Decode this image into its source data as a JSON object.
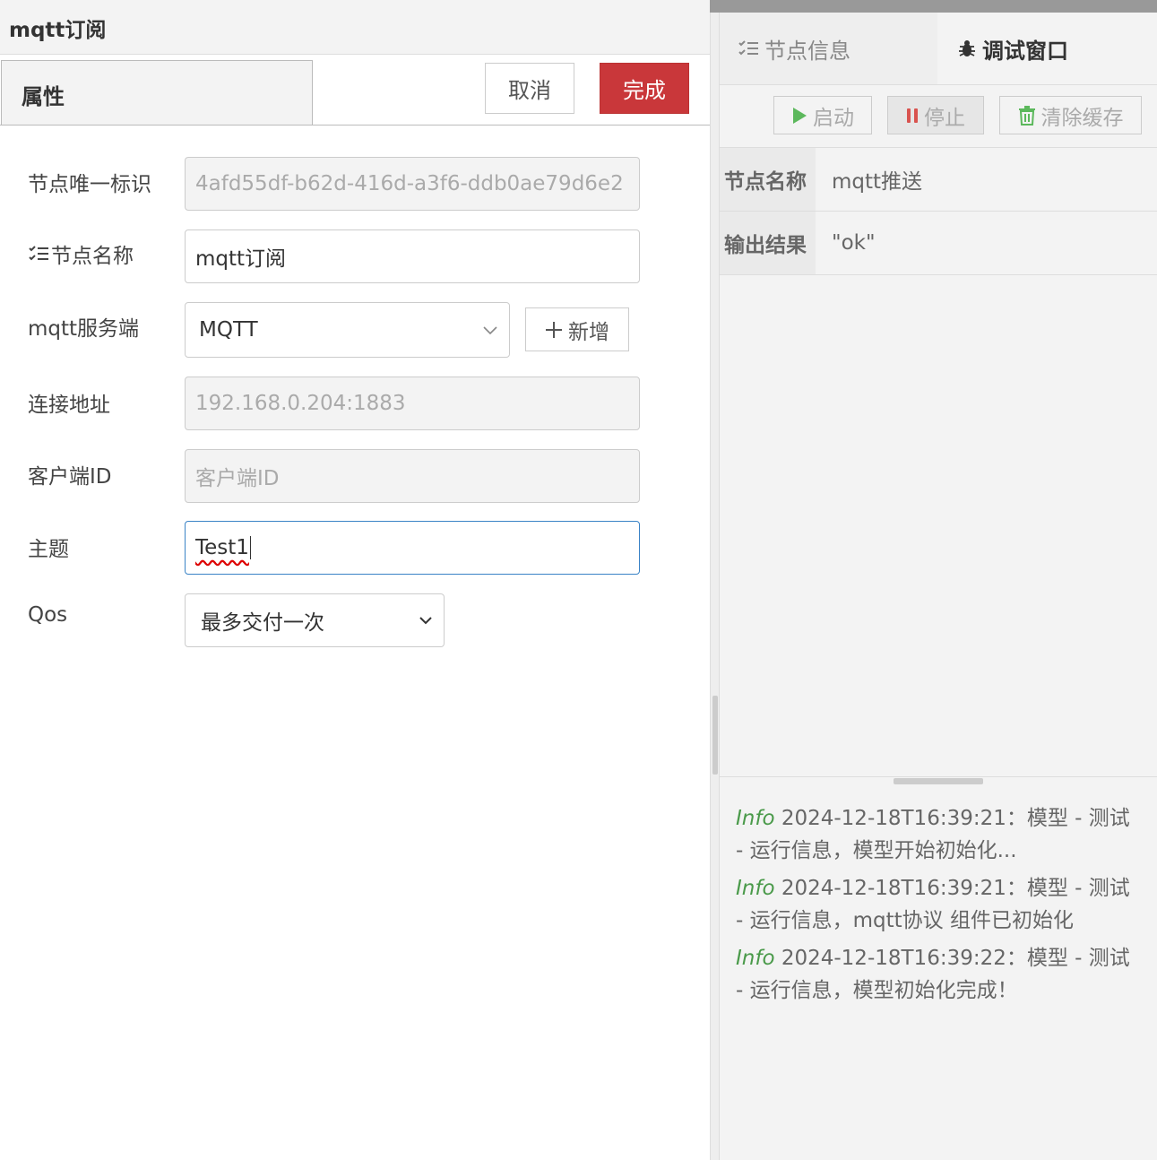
{
  "left_panel": {
    "title": "mqtt订阅",
    "tab_label": "属性",
    "cancel_label": "取消",
    "done_label": "完成",
    "fields": {
      "node_id_label": "节点唯一标识",
      "node_id_value": "4afd55df-b62d-416d-a3f6-ddb0ae79d6e2",
      "node_name_label": "节点名称",
      "node_name_value": "mqtt订阅",
      "server_label": "mqtt服务端",
      "server_value": "MQTT",
      "add_label": "新增",
      "address_label": "连接地址",
      "address_value": "192.168.0.204:1883",
      "client_id_label": "客户端ID",
      "client_id_placeholder": "客户端ID",
      "topic_label": "主题",
      "topic_value": "Test1",
      "qos_label": "Qos",
      "qos_value": "最多交付一次"
    }
  },
  "right_panel": {
    "tabs": {
      "info": "节点信息",
      "debug": "调试窗口"
    },
    "toolbar": {
      "start": "启动",
      "stop": "停止",
      "clear": "清除缓存"
    },
    "details": [
      {
        "key": "节点名称",
        "value": "mqtt推送"
      },
      {
        "key": "输出结果",
        "value": "\"ok\""
      }
    ],
    "logs": [
      {
        "level": "Info",
        "text": "2024-12-18T16:39:21：模型 - 测试 - 运行信息，模型开始初始化..."
      },
      {
        "level": "Info",
        "text": "2024-12-18T16:39:21：模型 - 测试 - 运行信息，mqtt协议 组件已初始化"
      },
      {
        "level": "Info",
        "text": "2024-12-18T16:39:22：模型 - 测试 - 运行信息，模型初始化完成！"
      }
    ],
    "colors": {
      "start_icon": "#5cb85c",
      "stop_icon": "#d9534f",
      "clear_icon": "#5cb85c",
      "log_level": "#4a9a4a"
    }
  },
  "colors": {
    "primary_button": "#c9373a",
    "focus_border": "#3a83c6"
  },
  "icons": [
    "list-icon",
    "bug-icon",
    "play-icon",
    "pause-icon",
    "trash-icon",
    "plus-icon",
    "chevron-down-icon"
  ]
}
